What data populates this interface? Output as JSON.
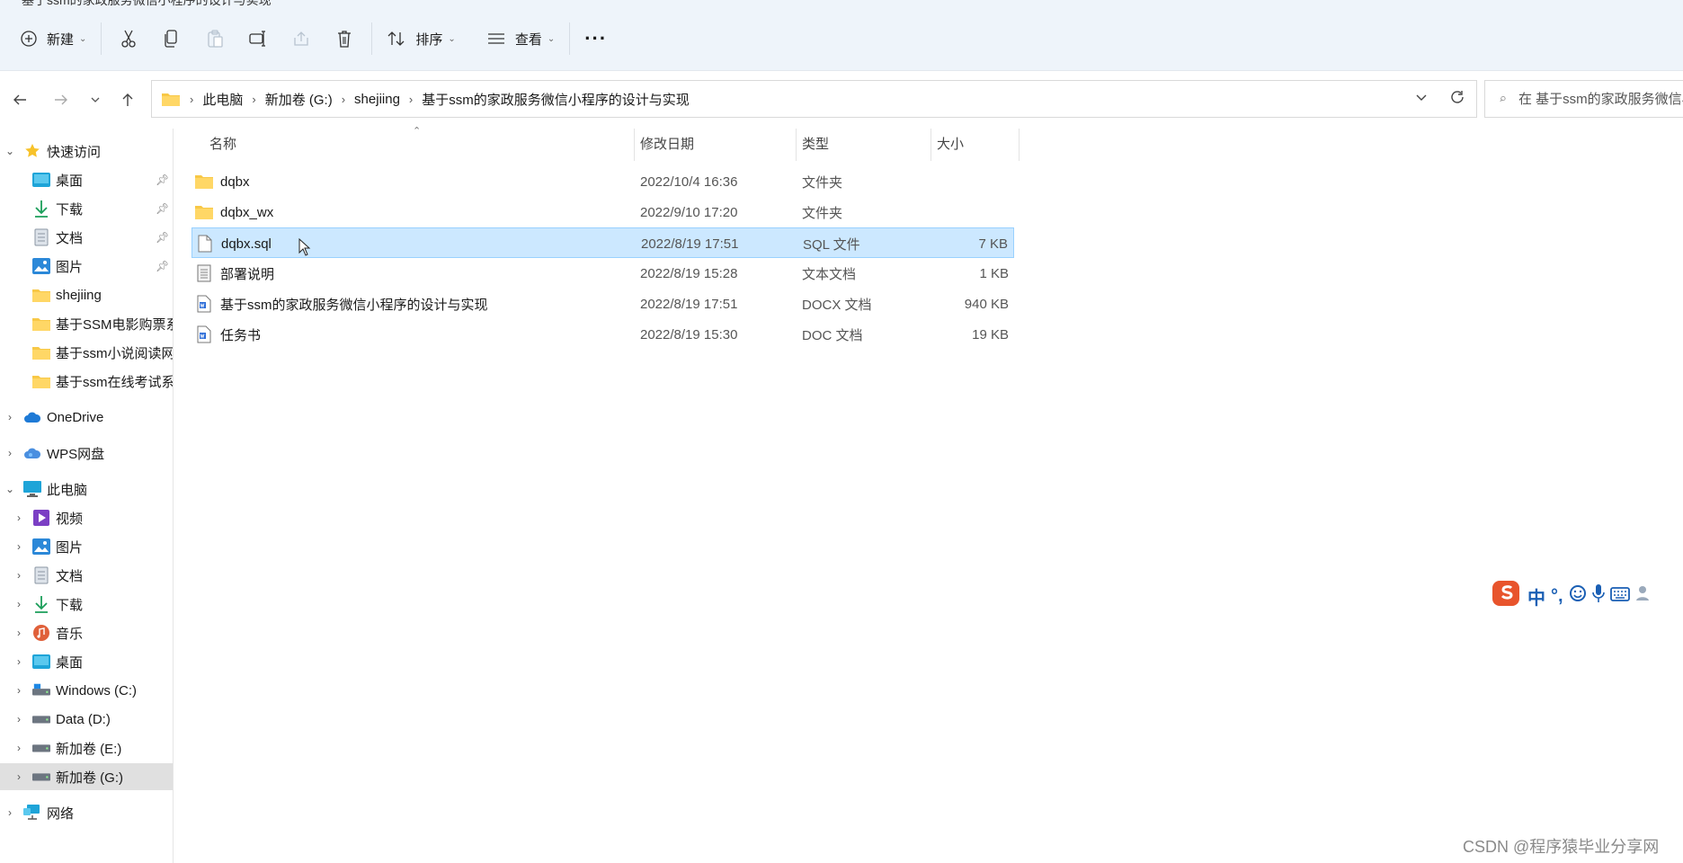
{
  "window": {
    "title": "基于ssm的家政服务微信小程序的设计与实现"
  },
  "toolbar": {
    "new_label": "新建",
    "sort_label": "排序",
    "view_label": "查看",
    "more_label": "···"
  },
  "address": {
    "crumbs": [
      "此电脑",
      "新加卷 (G:)",
      "shejiing",
      "基于ssm的家政服务微信小程序的设计与实现"
    ]
  },
  "search": {
    "placeholder": "在 基于ssm的家政服务微信小程序的设计与实现 中搜索"
  },
  "sidebar": {
    "quick_access": "快速访问",
    "quick_items": [
      "桌面",
      "下载",
      "文档",
      "图片",
      "shejiing",
      "基于SSM电影购票系统",
      "基于ssm小说阅读网站",
      "基于ssm在线考试系统"
    ],
    "onedrive": "OneDrive",
    "wps": "WPS网盘",
    "this_pc": "此电脑",
    "pc_items": [
      "视频",
      "图片",
      "文档",
      "下载",
      "音乐",
      "桌面",
      "Windows (C:)",
      "Data (D:)",
      "新加卷 (E:)",
      "新加卷 (G:)"
    ],
    "network": "网络"
  },
  "columns": {
    "name": "名称",
    "date": "修改日期",
    "type": "类型",
    "size": "大小"
  },
  "files": [
    {
      "name": "dqbx",
      "date": "2022/10/4 16:36",
      "type": "文件夹",
      "size": "",
      "icon": "folder-icon"
    },
    {
      "name": "dqbx_wx",
      "date": "2022/9/10 17:20",
      "type": "文件夹",
      "size": "",
      "icon": "folder-icon"
    },
    {
      "name": "dqbx.sql",
      "date": "2022/8/19 17:51",
      "type": "SQL 文件",
      "size": "7 KB",
      "icon": "file-icon"
    },
    {
      "name": "部署说明",
      "date": "2022/8/19 15:28",
      "type": "文本文档",
      "size": "1 KB",
      "icon": "text-file-icon"
    },
    {
      "name": "基于ssm的家政服务微信小程序的设计与实现",
      "date": "2022/8/19 17:51",
      "type": "DOCX 文档",
      "size": "940 KB",
      "icon": "word-doc-icon"
    },
    {
      "name": "任务书",
      "date": "2022/8/19 15:30",
      "type": "DOC 文档",
      "size": "19 KB",
      "icon": "word-doc-icon"
    }
  ],
  "ime": {
    "mode": "中",
    "punct": "°,"
  },
  "watermark": "CSDN @程序猿毕业分享网"
}
